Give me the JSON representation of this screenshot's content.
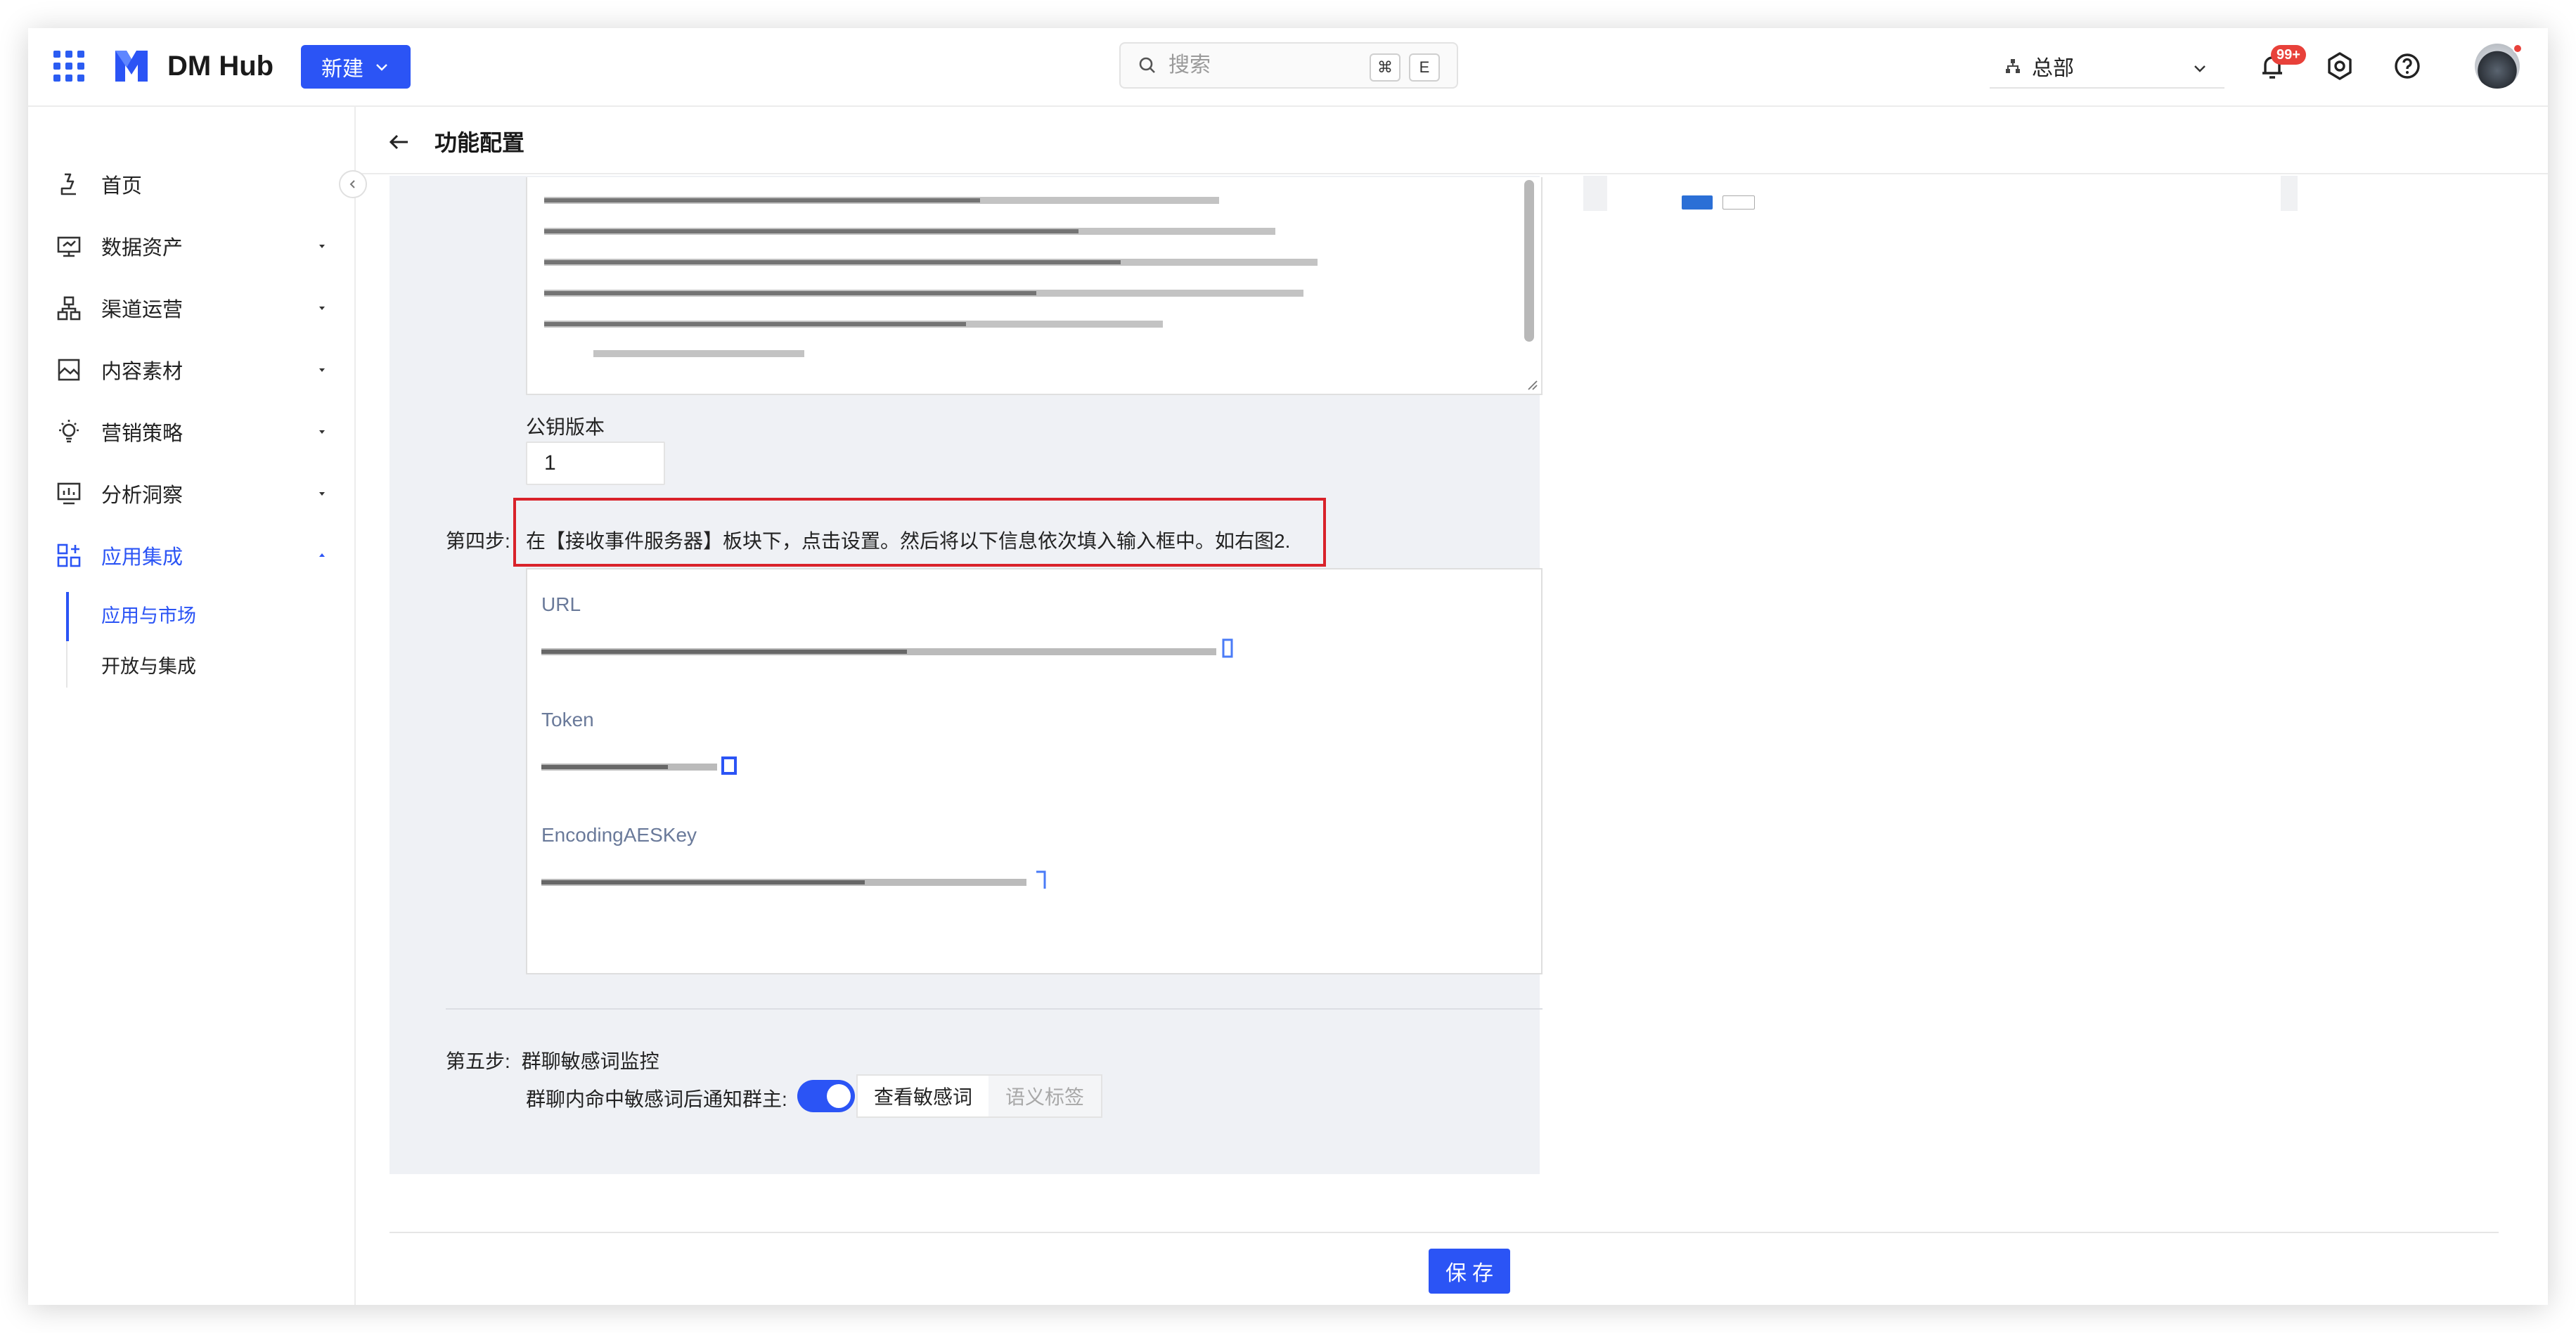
{
  "header": {
    "brand": "DM Hub",
    "new_button": "新建",
    "search_placeholder": "搜索",
    "shortcut_keys": [
      "⌘",
      "E"
    ],
    "org": "总部",
    "notification_badge": "99+"
  },
  "sidebar": {
    "items": [
      {
        "label": "首页",
        "icon": "home-icon"
      },
      {
        "label": "数据资产",
        "icon": "monitor-icon"
      },
      {
        "label": "渠道运营",
        "icon": "hierarchy-icon"
      },
      {
        "label": "内容素材",
        "icon": "image-icon"
      },
      {
        "label": "营销策略",
        "icon": "bulb-icon"
      },
      {
        "label": "分析洞察",
        "icon": "chart-icon"
      },
      {
        "label": "应用集成",
        "icon": "apps-icon"
      }
    ],
    "sub_items": [
      {
        "label": "应用与市场"
      },
      {
        "label": "开放与集成"
      }
    ]
  },
  "page": {
    "title": "功能配置"
  },
  "form": {
    "public_key_version_label": "公钥版本",
    "public_key_version_value": "1",
    "step4_label": "第四步:",
    "step4_text": "在【接收事件服务器】板块下，点击设置。然后将以下信息依次填入输入框中。如右图2.",
    "fields": {
      "url_label": "URL",
      "token_label": "Token",
      "aes_label": "EncodingAESKey"
    },
    "step5_label": "第五步:",
    "step5_title": "群聊敏感词监控",
    "step5_sub": "群聊内命中敏感词后通知群主:",
    "view_sensitive_button": "查看敏感词",
    "semantic_tag_button": "语义标签",
    "save_button": "保存"
  },
  "colors": {
    "accent": "#2b54f5",
    "highlight_border": "#d9222a",
    "panel_bg": "#eff1f5"
  }
}
